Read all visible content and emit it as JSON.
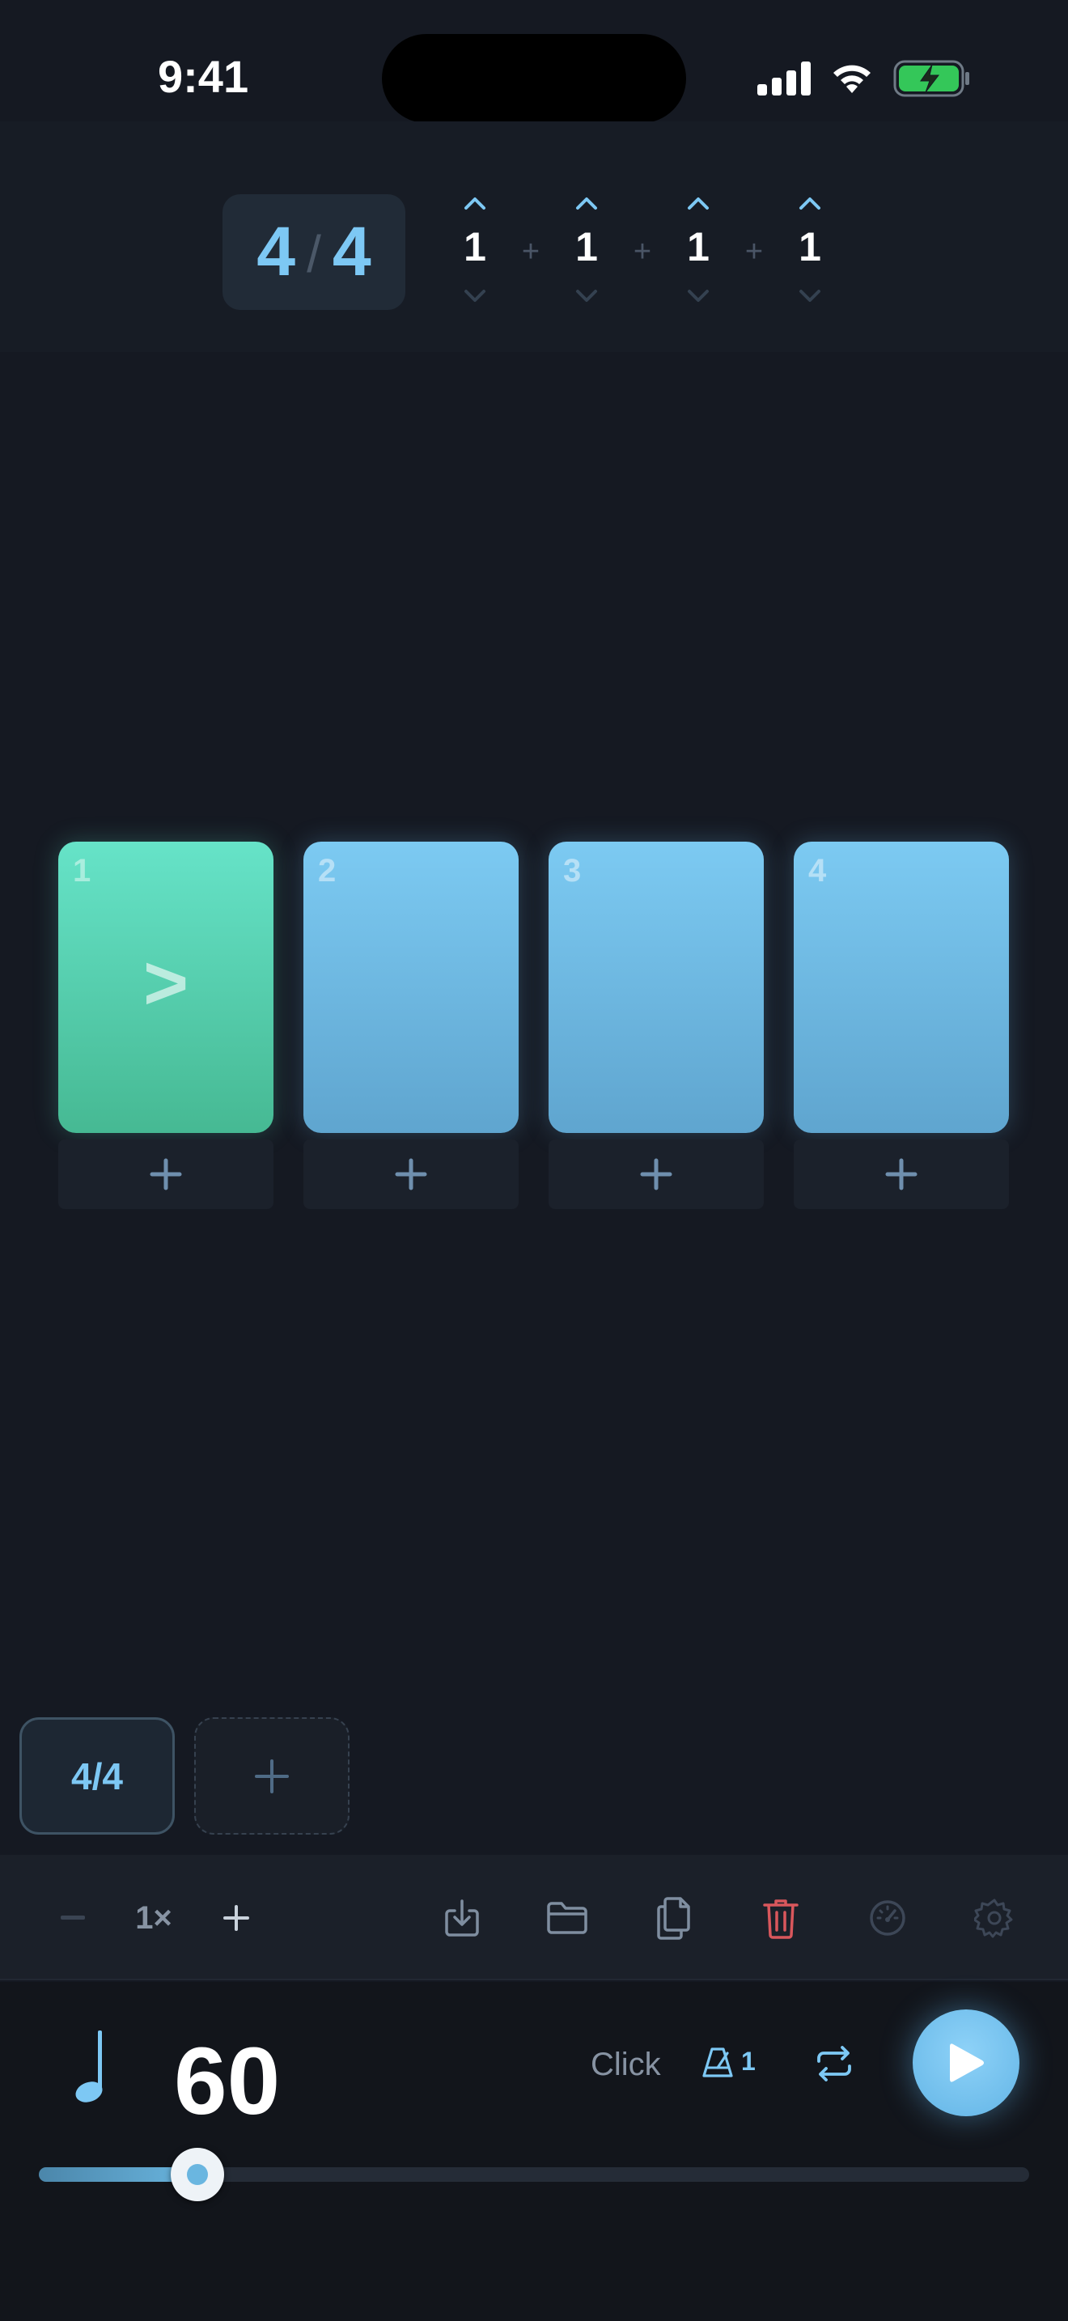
{
  "status_bar": {
    "time": "9:41"
  },
  "time_signature": {
    "numerator": "4",
    "slash": "/",
    "denominator": "4"
  },
  "beat_groups": {
    "values": [
      "1",
      "1",
      "1",
      "1"
    ],
    "separator": "+"
  },
  "beats": [
    {
      "number": "1",
      "active": true,
      "accent": ">"
    },
    {
      "number": "2",
      "active": false,
      "accent": ""
    },
    {
      "number": "3",
      "active": false,
      "accent": ""
    },
    {
      "number": "4",
      "active": false,
      "accent": ""
    }
  ],
  "measures": {
    "current_label": "4/4"
  },
  "toolbar": {
    "speed_label": "1×",
    "minus": "−",
    "plus": "+"
  },
  "transport": {
    "bpm": "60",
    "click_label": "Click",
    "metronome_count": "1",
    "tempo_slider_fraction": 0.16
  },
  "colors": {
    "accent_blue": "#7dc8f4",
    "active_beat": "#5ad6b8",
    "delete_red": "#d9575c",
    "background": "#151922"
  },
  "icons": {
    "status": [
      "cellular-signal-icon",
      "wifi-icon",
      "battery-charging-icon"
    ],
    "toolbar": [
      "import-icon",
      "folder-icon",
      "duplicate-icon",
      "trash-icon",
      "speedometer-icon",
      "gear-icon"
    ],
    "transport": [
      "quarter-note-icon",
      "metronome-icon",
      "repeat-icon",
      "play-icon"
    ]
  }
}
